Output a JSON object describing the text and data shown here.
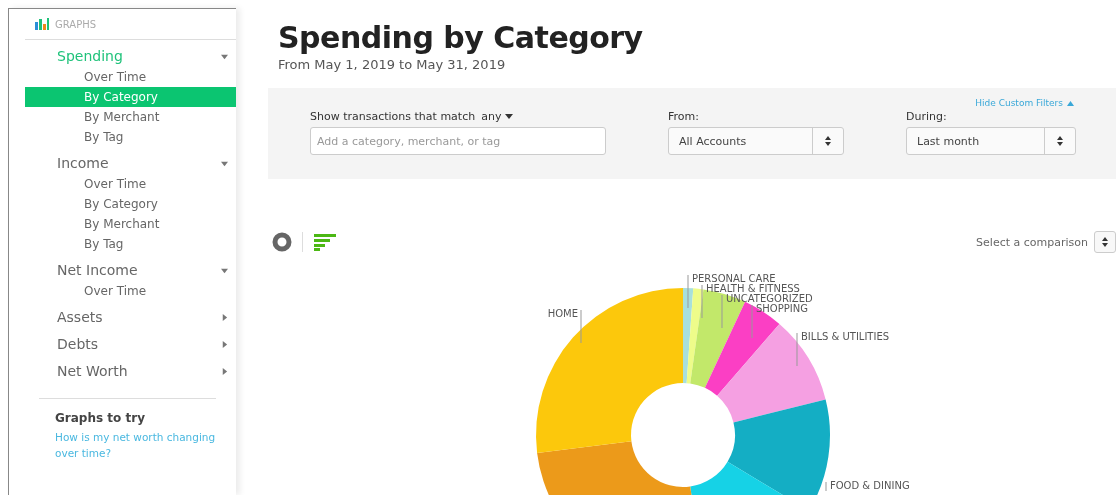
{
  "sidebar": {
    "heading": "GRAPHS",
    "groups": [
      {
        "label": "Spending",
        "selected": true,
        "expanded": true,
        "items": [
          {
            "label": "Over Time",
            "selected": false
          },
          {
            "label": "By Category",
            "selected": true
          },
          {
            "label": "By Merchant",
            "selected": false
          },
          {
            "label": "By Tag",
            "selected": false
          }
        ]
      },
      {
        "label": "Income",
        "selected": false,
        "expanded": true,
        "items": [
          {
            "label": "Over Time",
            "selected": false
          },
          {
            "label": "By Category",
            "selected": false
          },
          {
            "label": "By Merchant",
            "selected": false
          },
          {
            "label": "By Tag",
            "selected": false
          }
        ]
      },
      {
        "label": "Net Income",
        "selected": false,
        "expanded": true,
        "items": [
          {
            "label": "Over Time",
            "selected": false
          }
        ]
      },
      {
        "label": "Assets",
        "selected": false,
        "expanded": false
      },
      {
        "label": "Debts",
        "selected": false,
        "expanded": false
      },
      {
        "label": "Net Worth",
        "selected": false,
        "expanded": false
      }
    ],
    "try": {
      "heading": "Graphs to try",
      "link": "How is my net worth changing over time?"
    }
  },
  "page": {
    "title": "Spending by Category",
    "subtitle": "From May 1, 2019 to May 31, 2019"
  },
  "filters": {
    "hide_link": "Hide Custom Filters",
    "match_label": "Show transactions that match",
    "match_value": "any",
    "search": {
      "placeholder": "Add a category, merchant, or tag"
    },
    "from": {
      "label": "From:",
      "value": "All Accounts"
    },
    "during": {
      "label": "During:",
      "value": "Last month"
    }
  },
  "chart": {
    "comparison": "Select a comparison",
    "slices": [
      {
        "label": "PERSONAL CARE",
        "color": "#a8e0dc"
      },
      {
        "label": "HEALTH & FITNESS",
        "color": "#eefc8a"
      },
      {
        "label": "UNCATEGORIZED",
        "color": "#c2e86a"
      },
      {
        "label": "SHOPPING",
        "color": "#fb3fc4"
      },
      {
        "label": "BILLS & UTILITIES",
        "color": "#f5a0e2"
      },
      {
        "label": "FOOD & DINING",
        "color": "#14aec4"
      },
      {
        "color": "#16d2e6"
      },
      {
        "color": "#ec9a1a"
      },
      {
        "label": "HOME",
        "color": "#fcc80c"
      }
    ]
  }
}
